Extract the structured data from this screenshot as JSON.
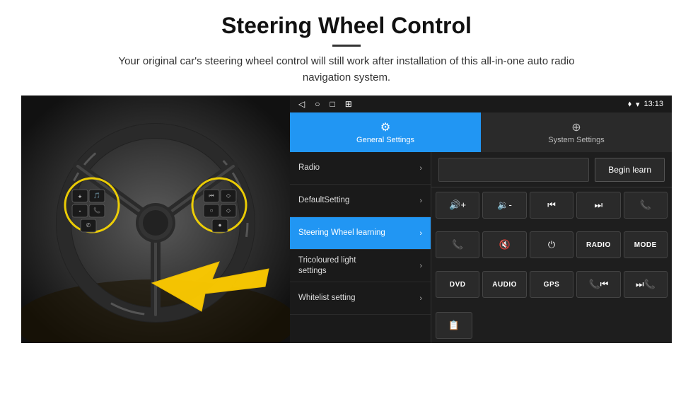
{
  "title": "Steering Wheel Control",
  "subtitle": "Your original car's steering wheel control will still work after installation of this all-in-one auto radio navigation system.",
  "divider": "",
  "android": {
    "nav_icons": [
      "◁",
      "○",
      "□",
      "⊞"
    ],
    "status": "♥ ▲  13:13",
    "tabs": [
      {
        "id": "general",
        "label": "General Settings",
        "icon": "⚙",
        "active": true
      },
      {
        "id": "system",
        "label": "System Settings",
        "icon": "⊕",
        "active": false
      }
    ],
    "menu_items": [
      {
        "label": "Radio",
        "active": false
      },
      {
        "label": "DefaultSetting",
        "active": false
      },
      {
        "label": "Steering Wheel learning",
        "active": true
      },
      {
        "label": "Tricoloured light settings",
        "active": false
      },
      {
        "label": "Whitelist setting",
        "active": false
      }
    ],
    "begin_learn_label": "Begin learn",
    "control_buttons": [
      {
        "label": "🔊+",
        "type": "icon"
      },
      {
        "label": "🔉-",
        "type": "icon"
      },
      {
        "label": "⏮",
        "type": "icon"
      },
      {
        "label": "⏭",
        "type": "icon"
      },
      {
        "label": "📞",
        "type": "icon"
      },
      {
        "label": "📞",
        "type": "icon-answer"
      },
      {
        "label": "🔇",
        "type": "icon-mute"
      },
      {
        "label": "⏻",
        "type": "icon-power"
      },
      {
        "label": "RADIO",
        "type": "text"
      },
      {
        "label": "MODE",
        "type": "text"
      },
      {
        "label": "DVD",
        "type": "text"
      },
      {
        "label": "AUDIO",
        "type": "text"
      },
      {
        "label": "GPS",
        "type": "text"
      },
      {
        "label": "📞⏮",
        "type": "icon-combo"
      },
      {
        "label": "⏭📞",
        "type": "icon-combo2"
      }
    ],
    "bottom_buttons": [
      {
        "label": "📋",
        "type": "icon"
      }
    ]
  }
}
